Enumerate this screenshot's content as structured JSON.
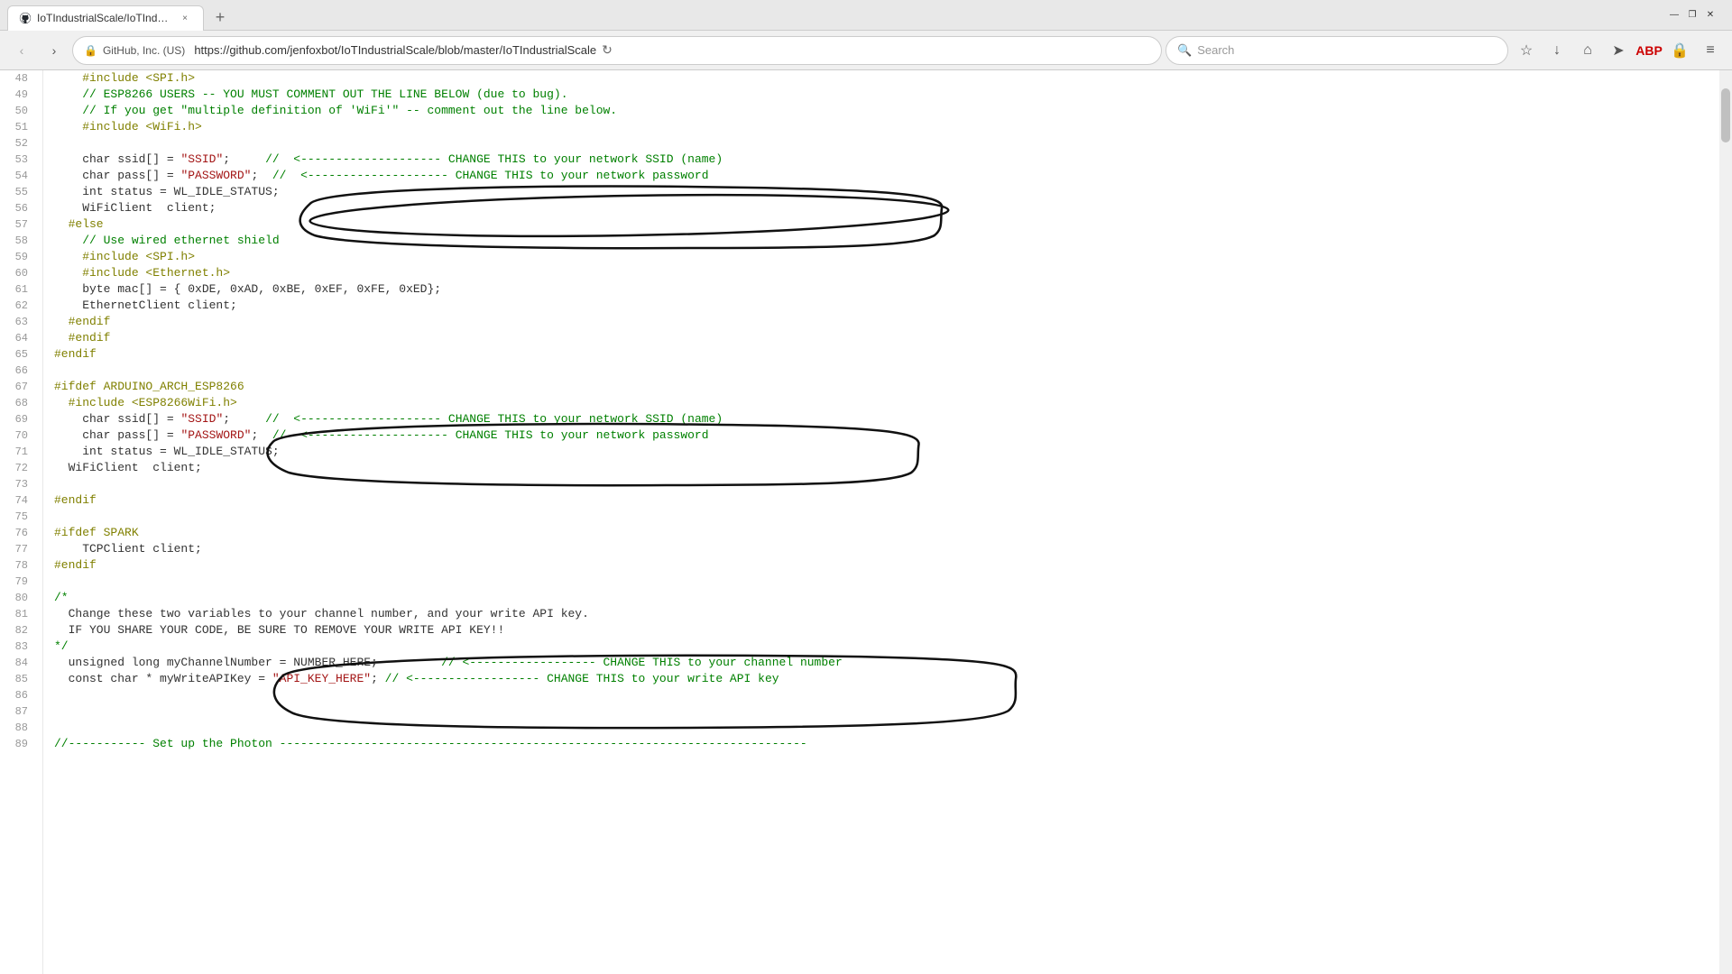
{
  "browser": {
    "tab": {
      "favicon": "github",
      "title": "IoTIndustrialScale/IoTIndu...",
      "close_label": "×"
    },
    "new_tab_label": "+",
    "window_controls": {
      "minimize": "—",
      "maximize": "❐",
      "close": "✕"
    },
    "nav": {
      "back": "‹",
      "forward": "›",
      "lock_label": "🔒",
      "address": "https://github.com/jenfoxbot/IoTIndustrialScale/blob/master/IoTIndustrialScale",
      "refresh": "↻",
      "search_placeholder": "Search"
    },
    "toolbar_icons": [
      "☆",
      "↓",
      "⌂",
      "➤",
      "🔴",
      "🔒",
      "≡"
    ]
  },
  "code": {
    "lines": [
      {
        "num": 48,
        "text": "    #include <SPI.h>"
      },
      {
        "num": 49,
        "text": "    // ESP8266 USERS -- YOU MUST COMMENT OUT THE LINE BELOW (due to bug)."
      },
      {
        "num": 50,
        "text": "    // If you get \"multiple definition of 'WiFi'\" -- comment out the line below."
      },
      {
        "num": 51,
        "text": "    #include <WiFi.h>"
      },
      {
        "num": 52,
        "text": ""
      },
      {
        "num": 53,
        "text": "    char ssid[] = \"SSID\";     //  <-------------------- CHANGE THIS to your network SSID (name)"
      },
      {
        "num": 54,
        "text": "    char pass[] = \"PASSWORD\";  //  <-------------------- CHANGE THIS to your network password"
      },
      {
        "num": 55,
        "text": "    int status = WL_IDLE_STATUS;"
      },
      {
        "num": 56,
        "text": "    WiFiClient  client;"
      },
      {
        "num": 57,
        "text": "  #else"
      },
      {
        "num": 58,
        "text": "    // Use wired ethernet shield"
      },
      {
        "num": 59,
        "text": "    #include <SPI.h>"
      },
      {
        "num": 60,
        "text": "    #include <Ethernet.h>"
      },
      {
        "num": 61,
        "text": "    byte mac[] = { 0xDE, 0xAD, 0xBE, 0xEF, 0xFE, 0xED};"
      },
      {
        "num": 62,
        "text": "    EthernetClient client;"
      },
      {
        "num": 63,
        "text": "  #endif"
      },
      {
        "num": 64,
        "text": "  #endif"
      },
      {
        "num": 65,
        "text": "#endif"
      },
      {
        "num": 66,
        "text": ""
      },
      {
        "num": 67,
        "text": "#ifdef ARDUINO_ARCH_ESP8266"
      },
      {
        "num": 68,
        "text": "  #include <ESP8266WiFi.h>"
      },
      {
        "num": 69,
        "text": "    char ssid[] = \"SSID\";     //  <-------------------- CHANGE THIS to your network SSID (name)"
      },
      {
        "num": 70,
        "text": "    char pass[] = \"PASSWORD\";  //  <-------------------- CHANGE THIS to your network password"
      },
      {
        "num": 71,
        "text": "    int status = WL_IDLE_STATUS;"
      },
      {
        "num": 72,
        "text": "  WiFiClient  client;"
      },
      {
        "num": 73,
        "text": ""
      },
      {
        "num": 74,
        "text": "#endif"
      },
      {
        "num": 75,
        "text": ""
      },
      {
        "num": 76,
        "text": "#ifdef SPARK"
      },
      {
        "num": 77,
        "text": "    TCPClient client;"
      },
      {
        "num": 78,
        "text": "#endif"
      },
      {
        "num": 79,
        "text": ""
      },
      {
        "num": 80,
        "text": "/*"
      },
      {
        "num": 81,
        "text": "  Change these two variables to your channel number, and your write API key."
      },
      {
        "num": 82,
        "text": "  IF YOU SHARE YOUR CODE, BE SURE TO REMOVE YOUR WRITE API KEY!!"
      },
      {
        "num": 83,
        "text": "*/"
      },
      {
        "num": 84,
        "text": "  unsigned long myChannelNumber = NUMBER_HERE;         // <------------------ CHANGE THIS to your channel number"
      },
      {
        "num": 85,
        "text": "  const char * myWriteAPIKey = \"API_KEY_HERE\"; // <------------------ CHANGE THIS to your write API key"
      },
      {
        "num": 86,
        "text": ""
      },
      {
        "num": 87,
        "text": ""
      },
      {
        "num": 88,
        "text": ""
      },
      {
        "num": 89,
        "text": "//----------- Set up the Photon ---------------------------------------------------------------------------"
      }
    ]
  }
}
